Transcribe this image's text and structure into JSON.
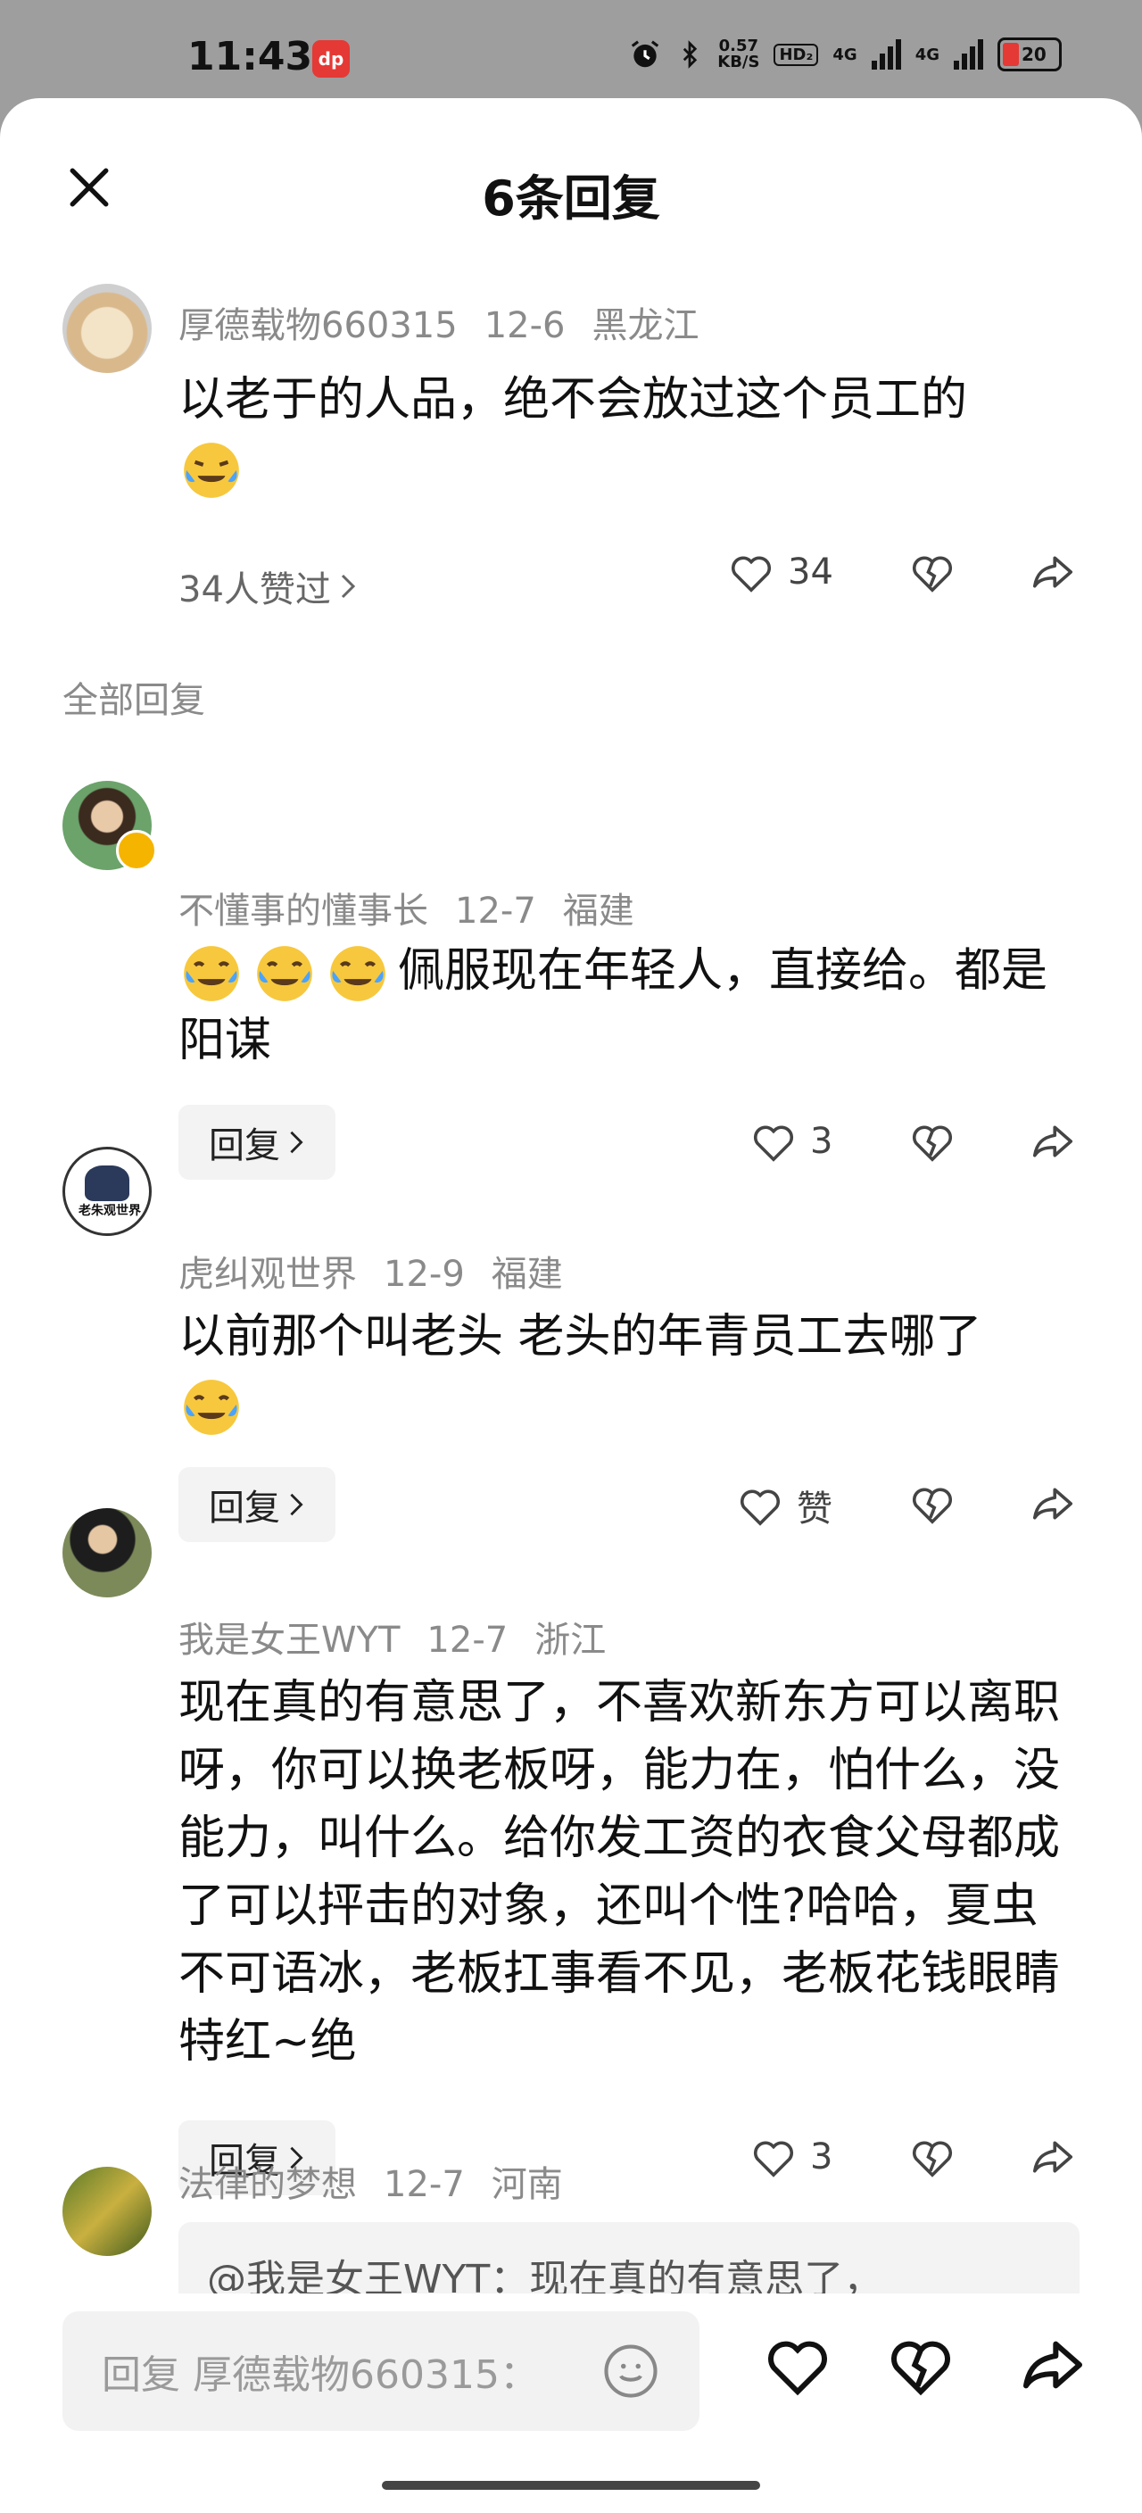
{
  "status": {
    "time": "11:43",
    "app_badge": "dp",
    "net_speed": "0.57\nKB/S",
    "hd": "HD₂",
    "sig1": "4G",
    "sig2": "4G",
    "battery": "20",
    "colors": {
      "battery_fill": "#e53935"
    }
  },
  "sheet": {
    "title": "6条回复",
    "close_icon": "close-icon"
  },
  "top_comment": {
    "user": "厚德载物660315",
    "date": "12-6",
    "region": "黑龙江",
    "text": "以老于的人品，绝不会放过这个员工的",
    "emoji": "😭",
    "likers": "34人赞过",
    "like_count": "34"
  },
  "section_label": "全部回复",
  "replies": [
    {
      "user": "不懂事的懂事长",
      "date": "12-7",
      "region": "福建",
      "text": "佩服现在年轻人，直接给。都是阳谋",
      "reply_label": "回复",
      "like_count": "3"
    },
    {
      "user": "虎纠观世界",
      "date": "12-9",
      "region": "福建",
      "text": "以前那个叫老头 老头的年青员工去哪了",
      "reply_label": "回复",
      "like_count": "赞"
    },
    {
      "user": "我是女王WYT",
      "date": "12-7",
      "region": "浙江",
      "text": "现在真的有意思了，不喜欢新东方可以离职呀，你可以换老板呀，能力在，怕什么，没能力，叫什么。给你发工资的衣食父母都成了可以抨击的对象，还叫个性?哈哈，夏虫不可语冰，老板扛事看不见，老板花钱眼睛特红~绝",
      "reply_label": "回复",
      "like_count": "3"
    },
    {
      "user": "法律的梦想",
      "date": "12-7",
      "region": "河南",
      "quote": "@我是女王WYT：现在真的有意思了，"
    }
  ],
  "input": {
    "placeholder": "回复 厚德载物660315："
  }
}
